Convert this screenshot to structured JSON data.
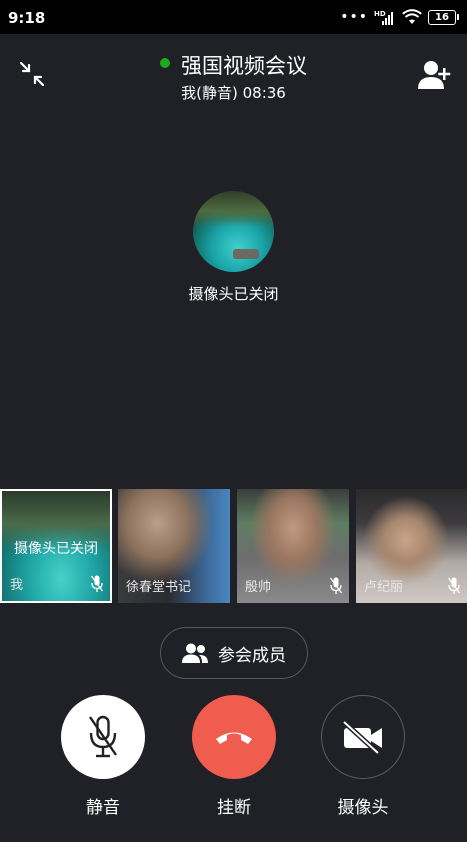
{
  "status_bar": {
    "time": "9:18",
    "network_label": "HD",
    "battery": "16"
  },
  "header": {
    "title": "强国视频会议",
    "subtitle": "我(静音) 08:36",
    "status_dot_color": "#1aad19"
  },
  "main_speaker": {
    "label": "摄像头已关闭"
  },
  "participants": [
    {
      "name": "我",
      "overlay_text": "摄像头已关闭",
      "muted": true,
      "selected": true
    },
    {
      "name": "徐春堂书记",
      "muted": false
    },
    {
      "name": "殷帅",
      "muted": true
    },
    {
      "name": "卢纪丽",
      "muted": true
    }
  ],
  "members_button": {
    "label": "参会成员"
  },
  "controls": {
    "mute_label": "静音",
    "hangup_label": "挂断",
    "camera_label": "摄像头",
    "hangup_color": "#f05c4d"
  },
  "icons": {
    "collapse": "collapse-arrows-icon",
    "add_member": "add-person-icon",
    "members": "people-icon",
    "mic_muted": "mic-off-icon",
    "phone": "phone-hangup-icon",
    "camera_off": "camera-off-icon"
  }
}
